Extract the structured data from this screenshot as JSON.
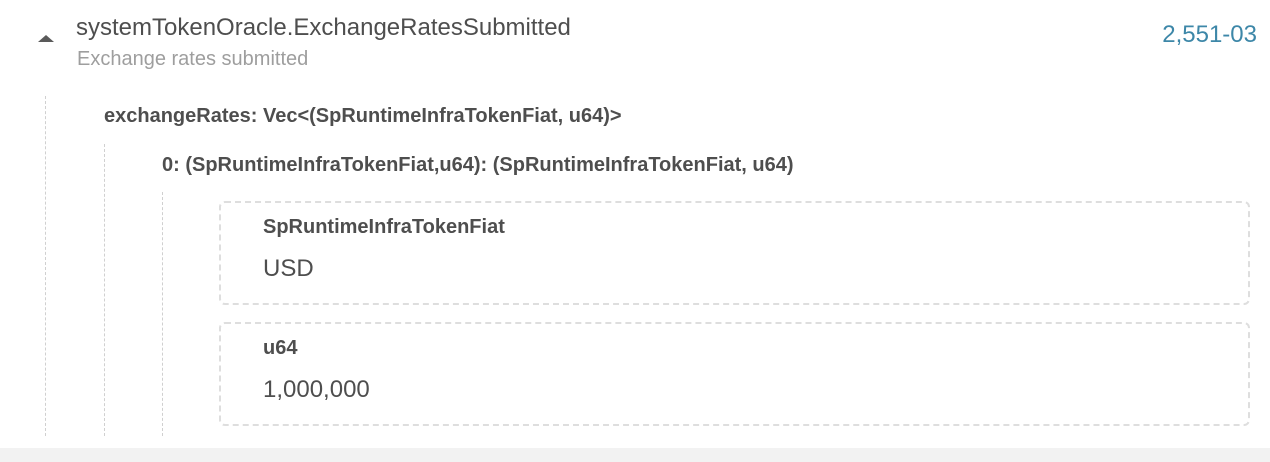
{
  "event": {
    "name": "systemTokenOracle.ExchangeRatesSubmitted",
    "description": "Exchange rates submitted",
    "block": "2,551-03"
  },
  "params": {
    "exchange_rates_label": "exchangeRates: Vec<(SpRuntimeInfraTokenFiat, u64)>",
    "item_0_label": "0: (SpRuntimeInfraTokenFiat,u64): (SpRuntimeInfraTokenFiat, u64)",
    "fields": [
      {
        "label": "SpRuntimeInfraTokenFiat",
        "value": "USD"
      },
      {
        "label": "u64",
        "value": "1,000,000"
      }
    ]
  },
  "icons": {
    "collapse": "caret-up-icon"
  },
  "colors": {
    "link": "#3d87a8",
    "text": "#4e4e4e",
    "muted": "#9e9e9e"
  }
}
